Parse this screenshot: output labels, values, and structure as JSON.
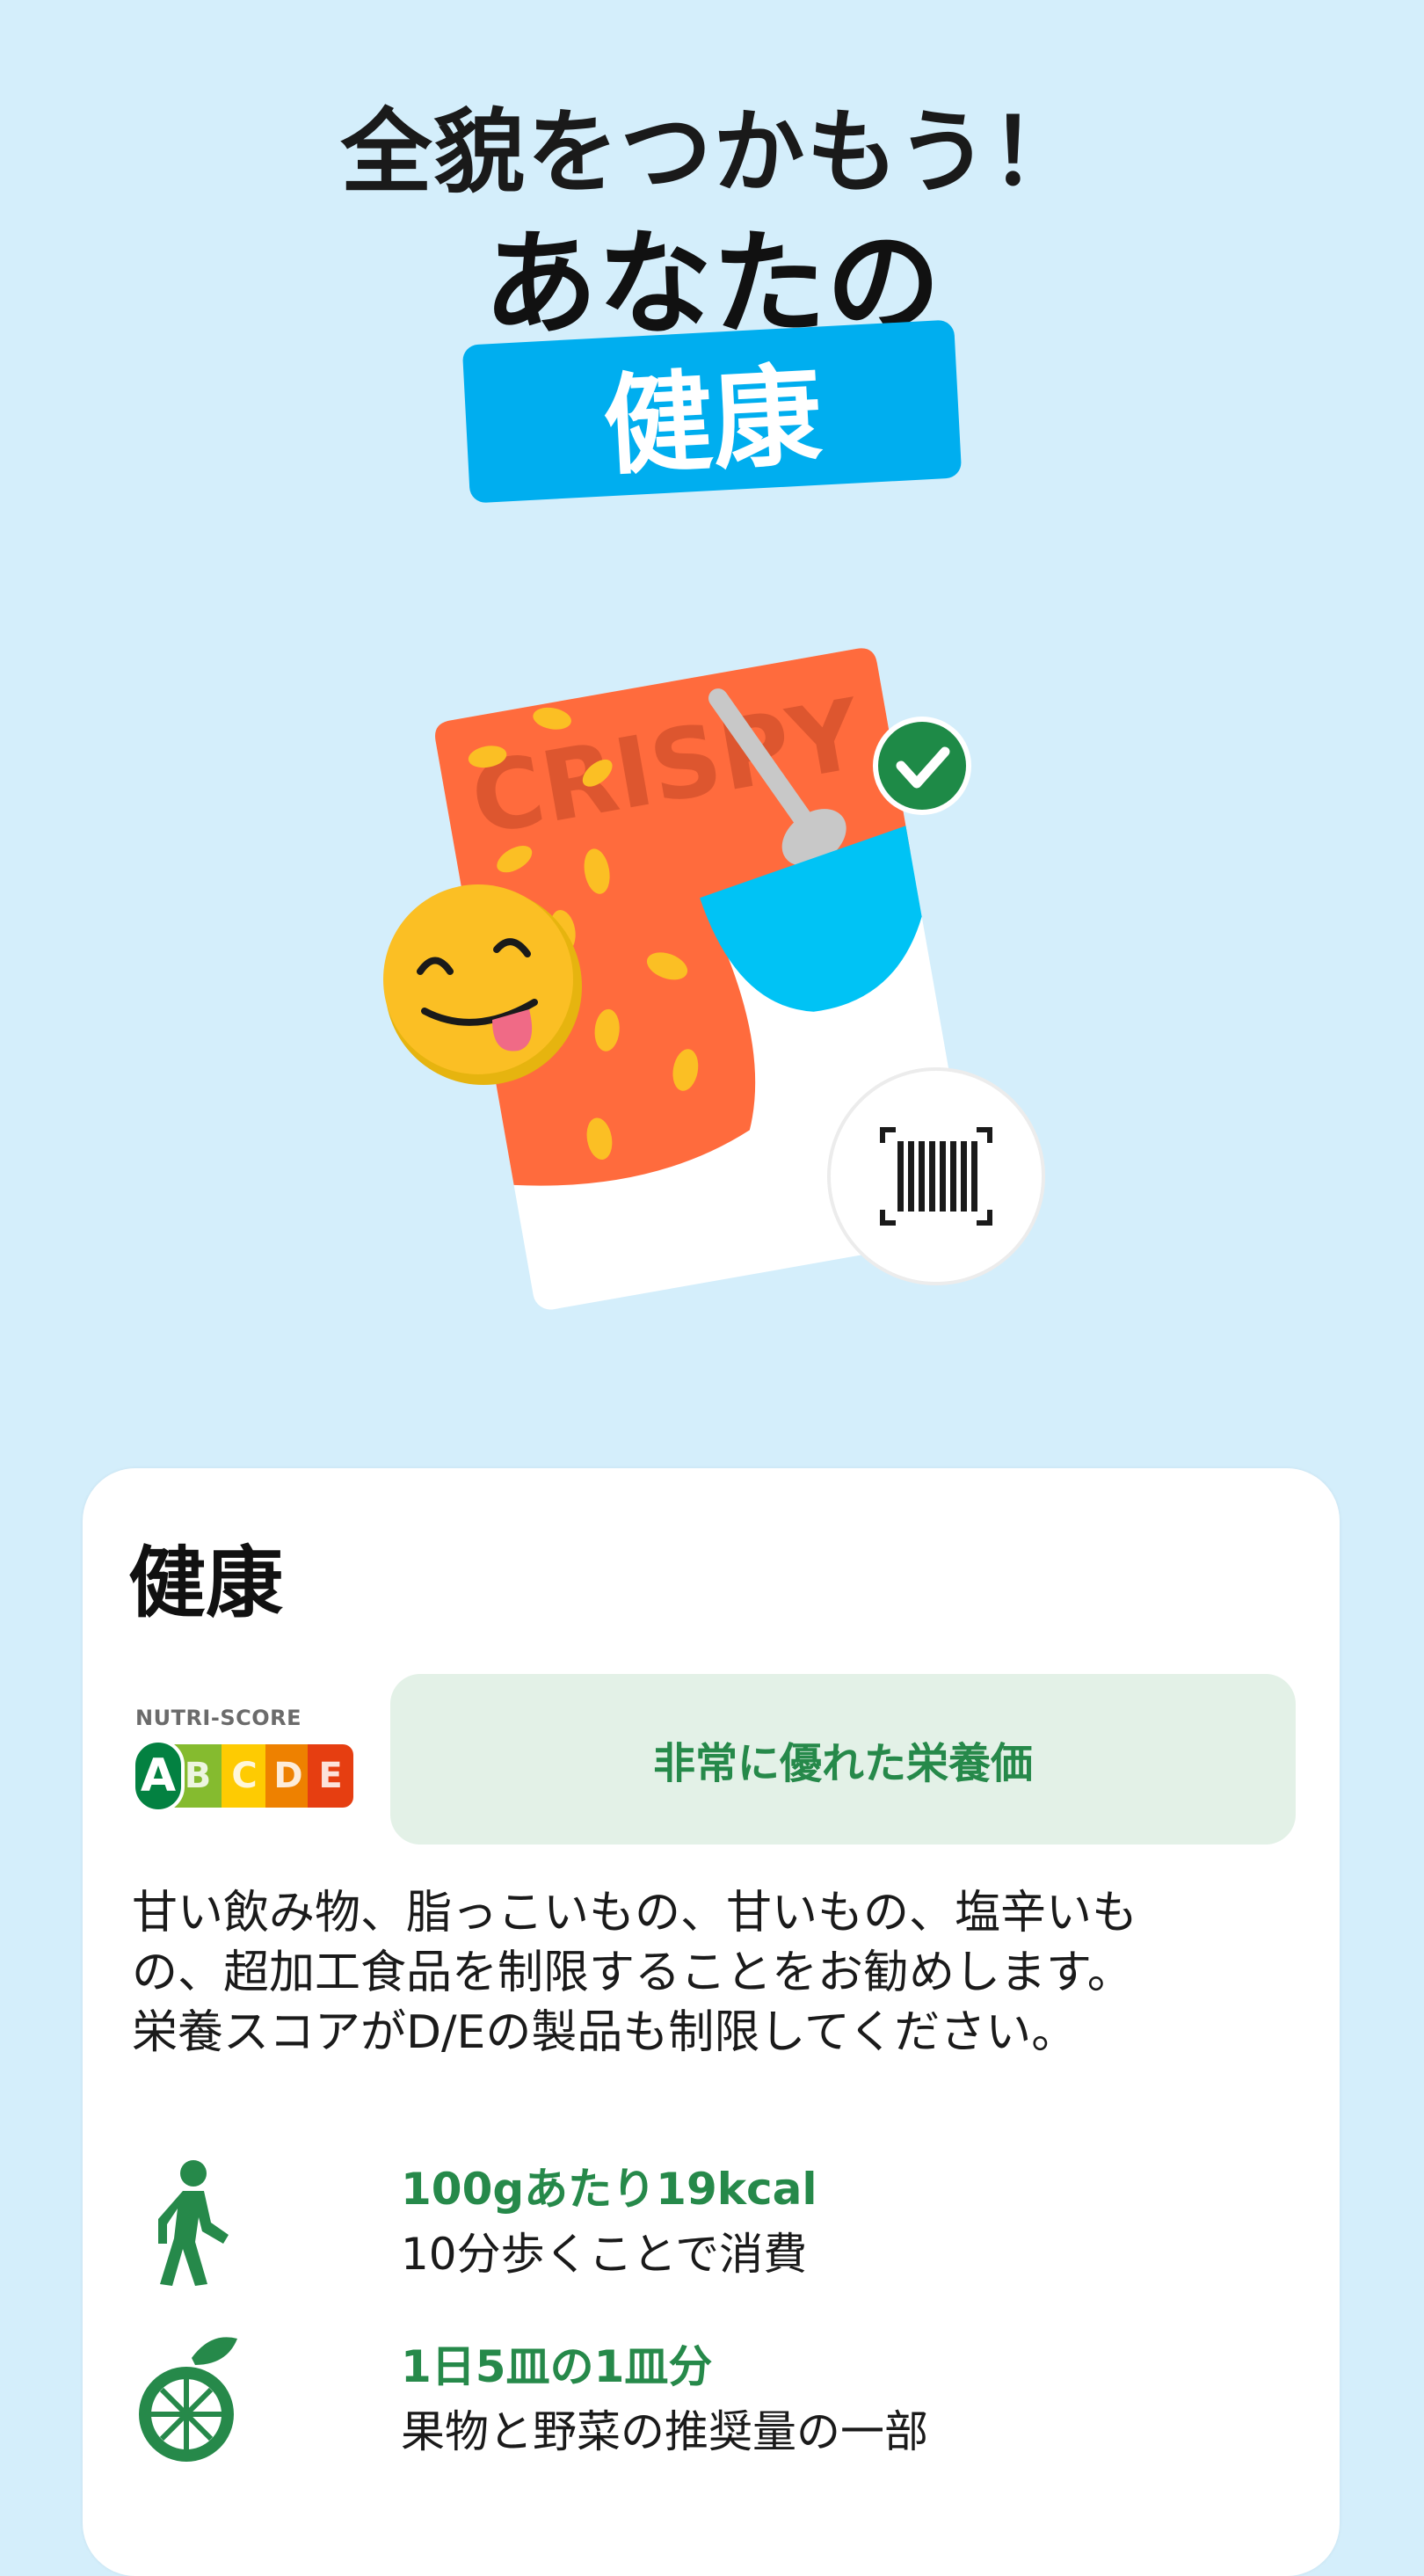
{
  "hero": {
    "line1": "全貌をつかもう！",
    "line2": "あなたの",
    "badge": "健康"
  },
  "illustration": {
    "package_text": "CRISPY",
    "icons": [
      "smiling-face-icon",
      "checkmark-icon",
      "barcode-scan-icon"
    ]
  },
  "card": {
    "title": "健康",
    "nutri_score": {
      "label": "NUTRI-SCORE",
      "grades": [
        "A",
        "B",
        "C",
        "D",
        "E"
      ],
      "selected": "A",
      "colors": [
        "#038141",
        "#85bb2f",
        "#fecb02",
        "#ee8100",
        "#e63e11"
      ]
    },
    "grade_text": "非常に優れた栄養価",
    "description_lines": [
      "甘い飲み物、脂っこいもの、甘いもの、塩辛いも",
      "の、超加工食品を制限することをお勧めします。",
      "栄養スコアがD/Eの製品も制限してください。"
    ],
    "items": [
      {
        "icon": "walking-person-icon",
        "title": "100gあたり19kcal",
        "subtitle": "10分歩くことで消費"
      },
      {
        "icon": "orange-fruit-icon",
        "title": "1日5皿の1皿分",
        "subtitle": "果物と野菜の推奨量の一部"
      }
    ]
  },
  "colors": {
    "background": "#d4eefb",
    "accent_blue": "#00aeef",
    "green": "#26894a",
    "grade_bg": "#e3f1e7"
  }
}
